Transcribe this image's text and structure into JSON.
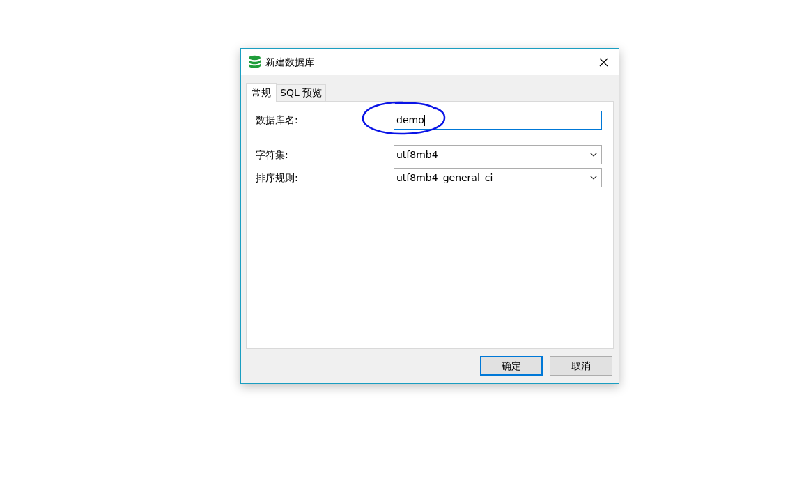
{
  "window": {
    "title": "新建数据库"
  },
  "tabs": [
    {
      "label": "常规",
      "selected": true
    },
    {
      "label": "SQL 预览",
      "selected": false
    }
  ],
  "fields": [
    {
      "kind": "text",
      "label": "数据库名:",
      "value": "demo",
      "focused": true
    },
    {
      "kind": "select",
      "label": "字符集:",
      "value": "utf8mb4"
    },
    {
      "kind": "select",
      "label": "排序规则:",
      "value": "utf8mb4_general_ci"
    }
  ],
  "buttons": [
    {
      "label": "确定",
      "default": true
    },
    {
      "label": "取消",
      "default": false
    }
  ]
}
